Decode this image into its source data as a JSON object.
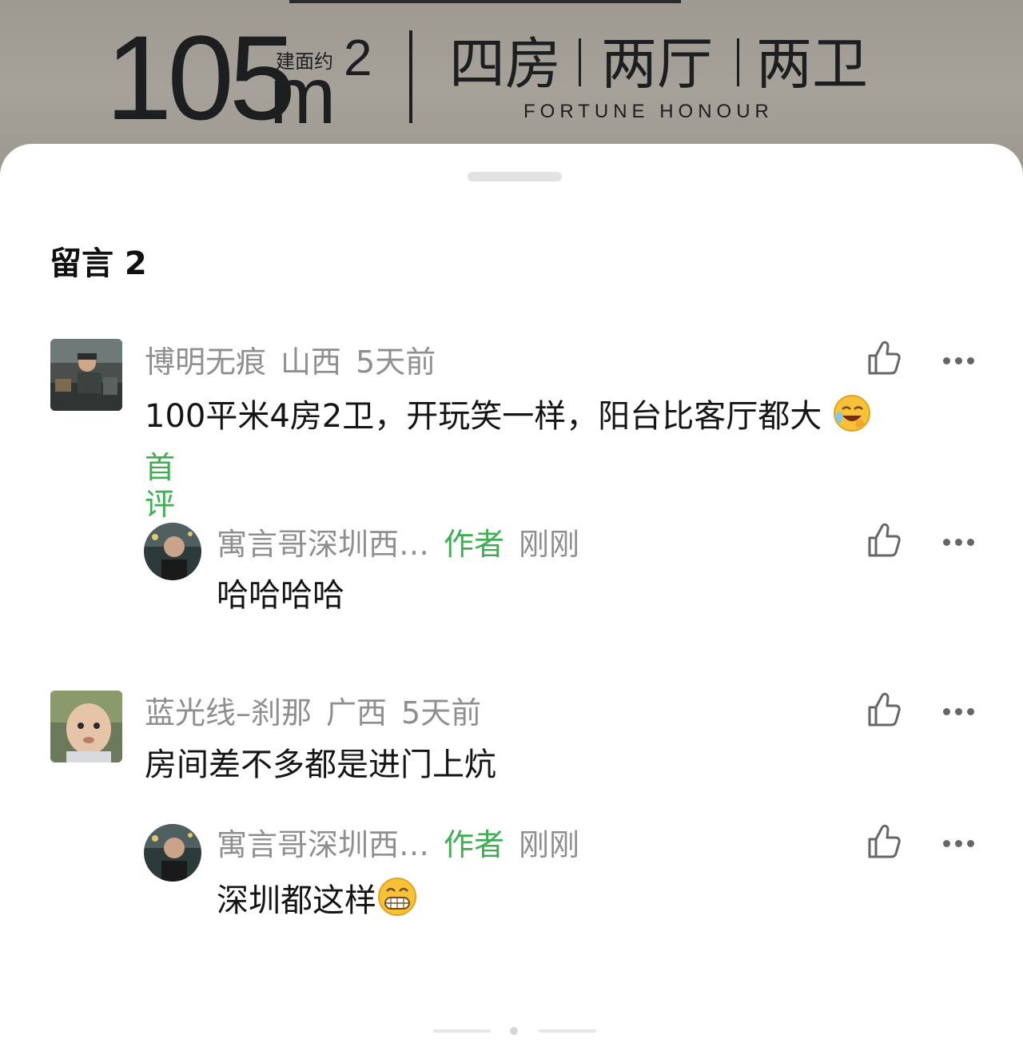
{
  "banner": {
    "area_number": "105",
    "area_unit": "m",
    "area_unit_sup": "2",
    "area_note": "建面约",
    "rooms": [
      "四房",
      "两厅",
      "两卫"
    ],
    "slogan": "FORTUNE HONOUR"
  },
  "comments_section": {
    "title": "留言 2"
  },
  "comments": [
    {
      "user": "博明无痕",
      "location": "山西",
      "time": "5天前",
      "text": "100平米4房2卫，开玩笑一样，阳台比客厅都大",
      "emoji": "laughing-crying-emoji",
      "tag": "首评",
      "reply": {
        "user": "寓言哥深圳西…",
        "badge": "作者",
        "time": "刚刚",
        "text": "哈哈哈哈"
      }
    },
    {
      "user": "蓝光线–刹那",
      "location": "广西",
      "time": "5天前",
      "text": "房间差不多都是进门上炕",
      "reply": {
        "user": "寓言哥深圳西…",
        "badge": "作者",
        "time": "刚刚",
        "text": "深圳都这样",
        "emoji": "grinning-emoji"
      }
    }
  ],
  "colors": {
    "accent_green": "#3fae52",
    "meta_gray": "#8f8f8f",
    "text": "#151515"
  },
  "icons": [
    "thumbs-up-icon",
    "more-dots-icon"
  ]
}
